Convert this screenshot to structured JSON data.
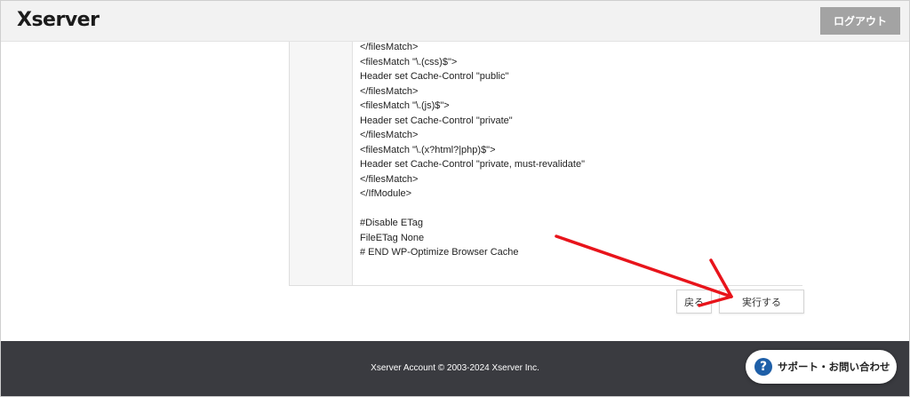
{
  "header": {
    "logo_text": "Xserver",
    "logout_label": "ログアウト"
  },
  "code_panel": {
    "lines": [
      "</filesMatch>",
      "<filesMatch \"\\.(css)$\">",
      "Header set Cache-Control \"public\"",
      "</filesMatch>",
      "<filesMatch \"\\.(js)$\">",
      "Header set Cache-Control \"private\"",
      "</filesMatch>",
      "<filesMatch \"\\.(x?html?|php)$\">",
      "Header set Cache-Control \"private, must-revalidate\"",
      "</filesMatch>",
      "</IfModule>",
      "",
      "#Disable ETag",
      "FileETag None",
      "# END WP-Optimize Browser Cache"
    ]
  },
  "actions": {
    "back_label": "戻る",
    "execute_label": "実行する"
  },
  "footer": {
    "copyright": "Xserver Account © 2003-2024 Xserver Inc."
  },
  "support": {
    "icon": "question-icon",
    "icon_glyph": "?",
    "label": "サポート・お問い合わせ"
  },
  "annotation": {
    "arrow_color": "#e8141b"
  }
}
